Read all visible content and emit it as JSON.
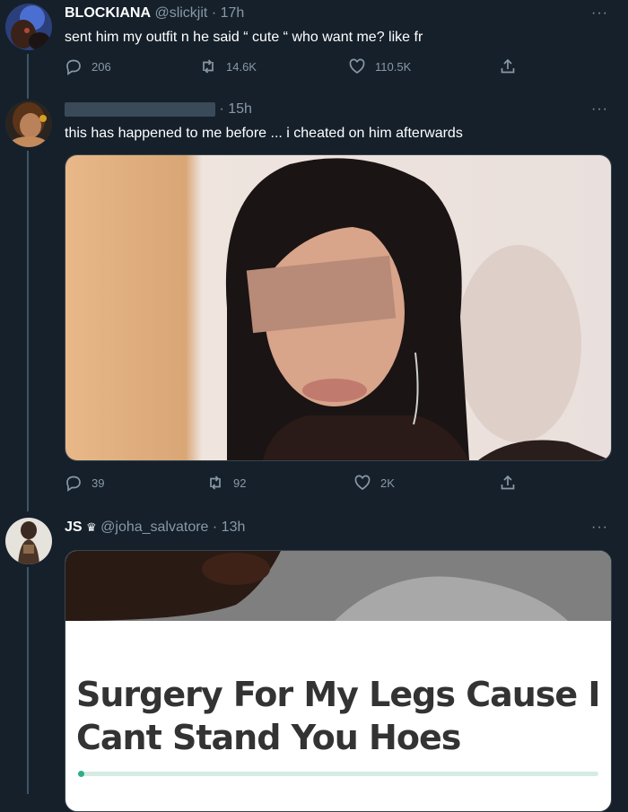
{
  "tweets": [
    {
      "name": "BLOCKIANA",
      "handle": "@slickjit",
      "time": "· 17h",
      "text": "sent him my outfit n he said “ cute “ who want me? like fr",
      "more": "···",
      "replies": "206",
      "retweets": "14.6K",
      "likes": "110.5K"
    },
    {
      "name_redacted": true,
      "time": "· 15h",
      "text": "this has happened to me before ... i cheated on him afterwards",
      "more": "···",
      "replies": "39",
      "retweets": "92",
      "likes": "2K"
    },
    {
      "name": "JS",
      "name_badge": "crown-icon",
      "handle": "@joha_salvatore",
      "time": "· 13h",
      "more": "···",
      "card": {
        "title_line1": "Surgery For My Legs Cause I",
        "title_line2": "Cant Stand You Hoes",
        "progress_percent": 1
      }
    }
  ],
  "colors": {
    "background": "#15202b",
    "secondary_text": "#8899a6",
    "primary_text": "#ffffff",
    "progress_accent": "#2fae8a"
  }
}
